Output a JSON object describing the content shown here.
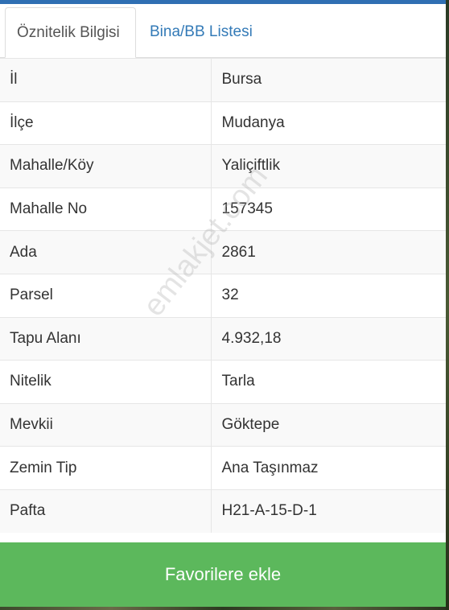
{
  "tabs": [
    {
      "label": "Öznitelik Bilgisi"
    },
    {
      "label": "Bina/BB Listesi"
    }
  ],
  "rows": [
    {
      "key": "İl",
      "value": "Bursa"
    },
    {
      "key": "İlçe",
      "value": "Mudanya"
    },
    {
      "key": "Mahalle/Köy",
      "value": "Yaliçiftlik"
    },
    {
      "key": "Mahalle No",
      "value": "157345"
    },
    {
      "key": "Ada",
      "value": "2861"
    },
    {
      "key": "Parsel",
      "value": "32"
    },
    {
      "key": "Tapu Alanı",
      "value": "4.932,18"
    },
    {
      "key": "Nitelik",
      "value": "Tarla"
    },
    {
      "key": "Mevkii",
      "value": "Göktepe"
    },
    {
      "key": "Zemin Tip",
      "value": "Ana Taşınmaz"
    },
    {
      "key": "Pafta",
      "value": "H21-A-15-D-1"
    }
  ],
  "watermark": "emlakjet.com",
  "favorite_button": "Favorilere ekle",
  "colors": {
    "accent": "#337ab7",
    "button": "#5cb85c"
  }
}
